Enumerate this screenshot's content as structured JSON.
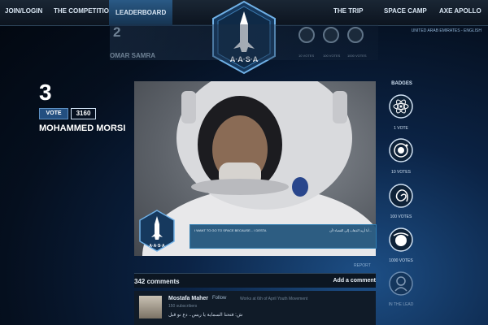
{
  "nav": {
    "left": [
      "JOIN/LOGIN",
      "THE COMPETITION",
      "LEADERBOARD"
    ],
    "right": [
      "THE TRIP",
      "SPACE CAMP",
      "AXE APOLLO"
    ],
    "active": "LEADERBOARD"
  },
  "logo": {
    "text": "A·A·S·A",
    "top_letter": "AXE"
  },
  "locale": "UNITED ARAB EMIRATES - ENGLISH",
  "rank2": {
    "number": "2",
    "name": "OMAR SAMRA",
    "badge_labels": [
      "1 VOTE",
      "10 VOTES",
      "100 VOTES",
      "1000 VOTES"
    ]
  },
  "rank3": {
    "number": "3",
    "vote_label": "VOTE",
    "votes": "3160",
    "name": "MOHAMMED MORSI"
  },
  "caption": {
    "english": "I WANT TO GO TO SPACE BECAUSE... I DESTA",
    "arabic": "أنا أريد الذهاب إلى الفضاء لأن..."
  },
  "photo_logo_text": "A·A·S·A",
  "report_label": "REPORT",
  "comments": {
    "count_label": "342 comments",
    "add_label": "Add a comment",
    "items": [
      {
        "author": "Mostafa Maher",
        "follow": "Follow",
        "meta": "Works at 6th of April Youth Movement",
        "sub": "150 subscribers",
        "body": "ش: فتحنا السماية يا ريس.. دع نو قبل"
      }
    ]
  },
  "badges": {
    "title": "BADGES",
    "items": [
      {
        "label": "1 VOTE",
        "icon": "atom-icon"
      },
      {
        "label": "10 VOTES",
        "icon": "orbit-icon"
      },
      {
        "label": "100 VOTES",
        "icon": "galaxy-icon"
      },
      {
        "label": "1000 VOTES",
        "icon": "planet-icon"
      },
      {
        "label": "IN THE LEAD",
        "icon": "astronaut-icon"
      }
    ]
  },
  "colors": {
    "accent": "#234f80",
    "caption_bg": "#1c5078",
    "background": "#050f1e"
  }
}
